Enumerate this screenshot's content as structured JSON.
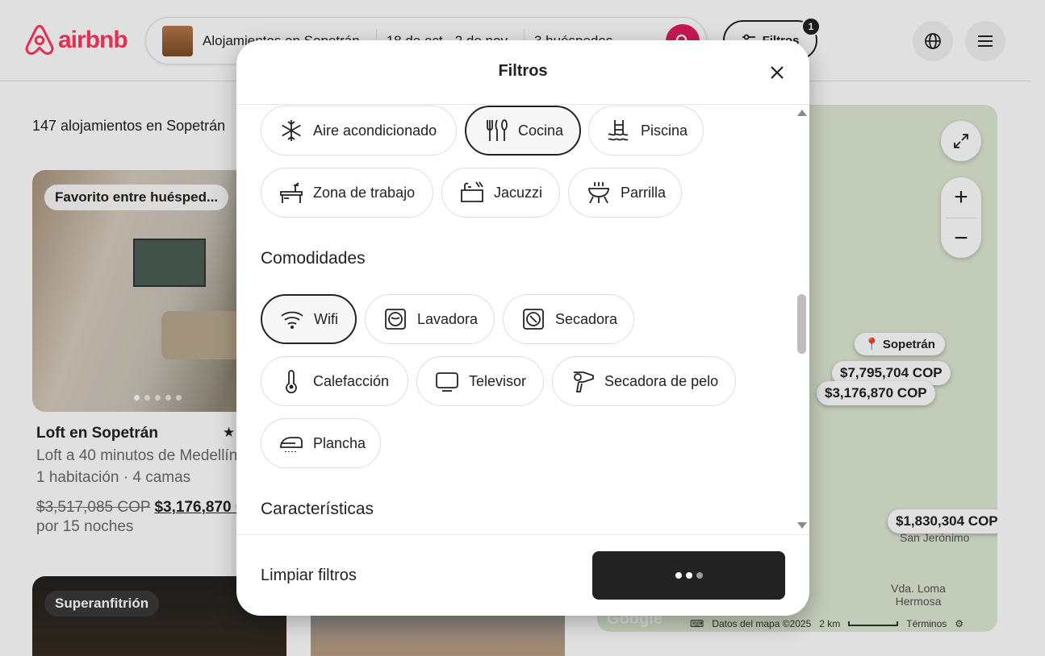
{
  "header": {
    "logo_text": "airbnb",
    "search_location": "Alojamientos en Sopetrán",
    "search_dates": "18 de oct - 2 de nov",
    "search_guests": "3 huéspedes",
    "filters_label": "Filtros",
    "filters_count": "1",
    "brand_color": "#FF385C"
  },
  "results": {
    "count_text": "147 alojamientos en Sopetrán",
    "listing": {
      "badge": "Favorito entre huésped...",
      "title": "Loft en Sopetrán",
      "subtitle": "Loft a 40 minutos de Medellín",
      "rooms": "1 habitación · 4 camas",
      "old_price": "$3,517,085 COP",
      "new_price": "$3,176,870 COP",
      "nights": "por 15 noches"
    },
    "listing2_badge": "Superanfitrión"
  },
  "map": {
    "place_name": "Sopetrán",
    "prices": [
      "$7,795,704 COP",
      "$3,176,870 COP",
      "$1,830,304 COP"
    ],
    "labels": [
      "San Jerónimo",
      "Vda. Loma Hermosa"
    ],
    "google": "Google",
    "footer": {
      "data": "Datos del mapa ©2025",
      "scale": "2 km",
      "terms": "Términos"
    }
  },
  "modal": {
    "title": "Filtros",
    "top_chips": [
      {
        "label": "Aire acondicionado",
        "icon": "snowflake-icon",
        "selected": false
      },
      {
        "label": "Cocina",
        "icon": "kitchen-utensils-icon",
        "selected": true
      },
      {
        "label": "Piscina",
        "icon": "pool-icon",
        "selected": false
      },
      {
        "label": "Zona de trabajo",
        "icon": "desk-icon",
        "selected": false
      },
      {
        "label": "Jacuzzi",
        "icon": "jacuzzi-icon",
        "selected": false
      },
      {
        "label": "Parrilla",
        "icon": "grill-icon",
        "selected": false
      }
    ],
    "amenities_title": "Comodidades",
    "amenity_chips": [
      {
        "label": "Wifi",
        "icon": "wifi-icon",
        "selected": true
      },
      {
        "label": "Lavadora",
        "icon": "washer-icon",
        "selected": false
      },
      {
        "label": "Secadora",
        "icon": "dryer-icon",
        "selected": false
      },
      {
        "label": "Calefacción",
        "icon": "thermometer-icon",
        "selected": false
      },
      {
        "label": "Televisor",
        "icon": "tv-icon",
        "selected": false
      },
      {
        "label": "Secadora de pelo",
        "icon": "hairdryer-icon",
        "selected": false
      },
      {
        "label": "Plancha",
        "icon": "iron-icon",
        "selected": false
      }
    ],
    "features_title": "Características",
    "clear_label": "Limpiar filtros",
    "show_button_state": "loading"
  }
}
